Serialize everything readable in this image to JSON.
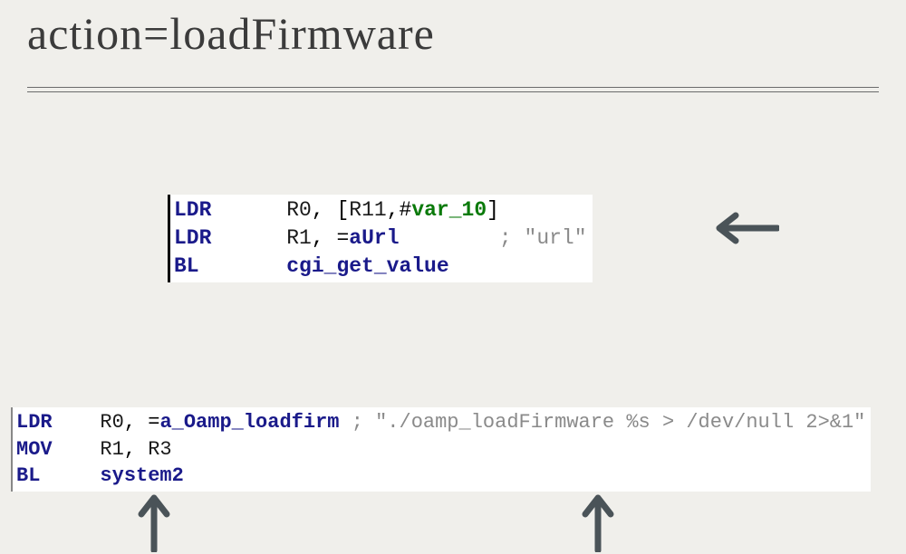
{
  "title": "action=loadFirmware",
  "block1": {
    "l1_mn": "LDR",
    "l1_r0": "R0",
    "l1_c1": ", [",
    "l1_r11": "R11",
    "l1_c2": ",#",
    "l1_var": "var_10",
    "l1_c3": "]",
    "l2_mn": "LDR",
    "l2_r1": "R1",
    "l2_c1": ", =",
    "l2_sym": "aUrl",
    "l2_cm": "; \"url\"",
    "l3_mn": "BL",
    "l3_fn": "cgi_get_value"
  },
  "block2": {
    "l1_mn": "LDR",
    "l1_r0": "R0",
    "l1_c1": ", =",
    "l1_sym": "a_Oamp_loadfirm",
    "l1_cm": "; \"./oamp_loadFirmware %s > /dev/null 2>&1\"",
    "l2_mn": "MOV",
    "l2_r1": "R1",
    "l2_c1": ", ",
    "l2_r3": "R3",
    "l3_mn": "BL",
    "l3_fn": "system2"
  }
}
